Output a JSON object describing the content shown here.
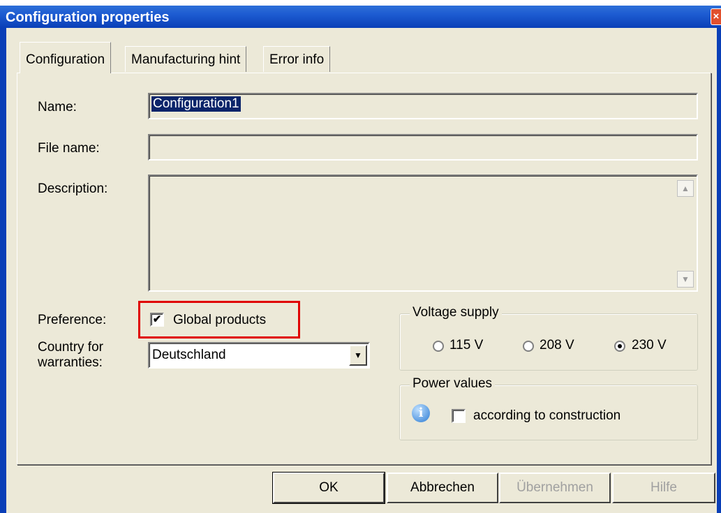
{
  "window": {
    "title": "Configuration properties",
    "close_glyph": "×"
  },
  "tabs": [
    {
      "label": "Configuration"
    },
    {
      "label": "Manufacturing hint"
    },
    {
      "label": "Error info"
    }
  ],
  "form": {
    "name_label": "Name:",
    "name_value": "Configuration1",
    "file_label": "File name:",
    "file_value": "",
    "description_label": "Description:",
    "description_value": "",
    "preference_label": "Preference:",
    "global_products_label": "Global products",
    "global_products_checked": true,
    "country_label_line1": "Country for",
    "country_label_line2": "warranties:",
    "country_value": "Deutschland"
  },
  "voltage": {
    "legend": "Voltage supply",
    "options": [
      {
        "label": "115 V",
        "selected": false
      },
      {
        "label": "208 V",
        "selected": false
      },
      {
        "label": "230 V",
        "selected": true
      }
    ]
  },
  "power": {
    "legend": "Power values",
    "checkbox_label": "according to construction",
    "checked": false,
    "icon": "info-icon"
  },
  "buttons": {
    "ok": "OK",
    "cancel": "Abbrechen",
    "apply": "Übernehmen",
    "help": "Hilfe"
  },
  "colors": {
    "titlebar": "#0a3fb7",
    "selection": "#0a246a",
    "highlight_box": "#e00000"
  }
}
